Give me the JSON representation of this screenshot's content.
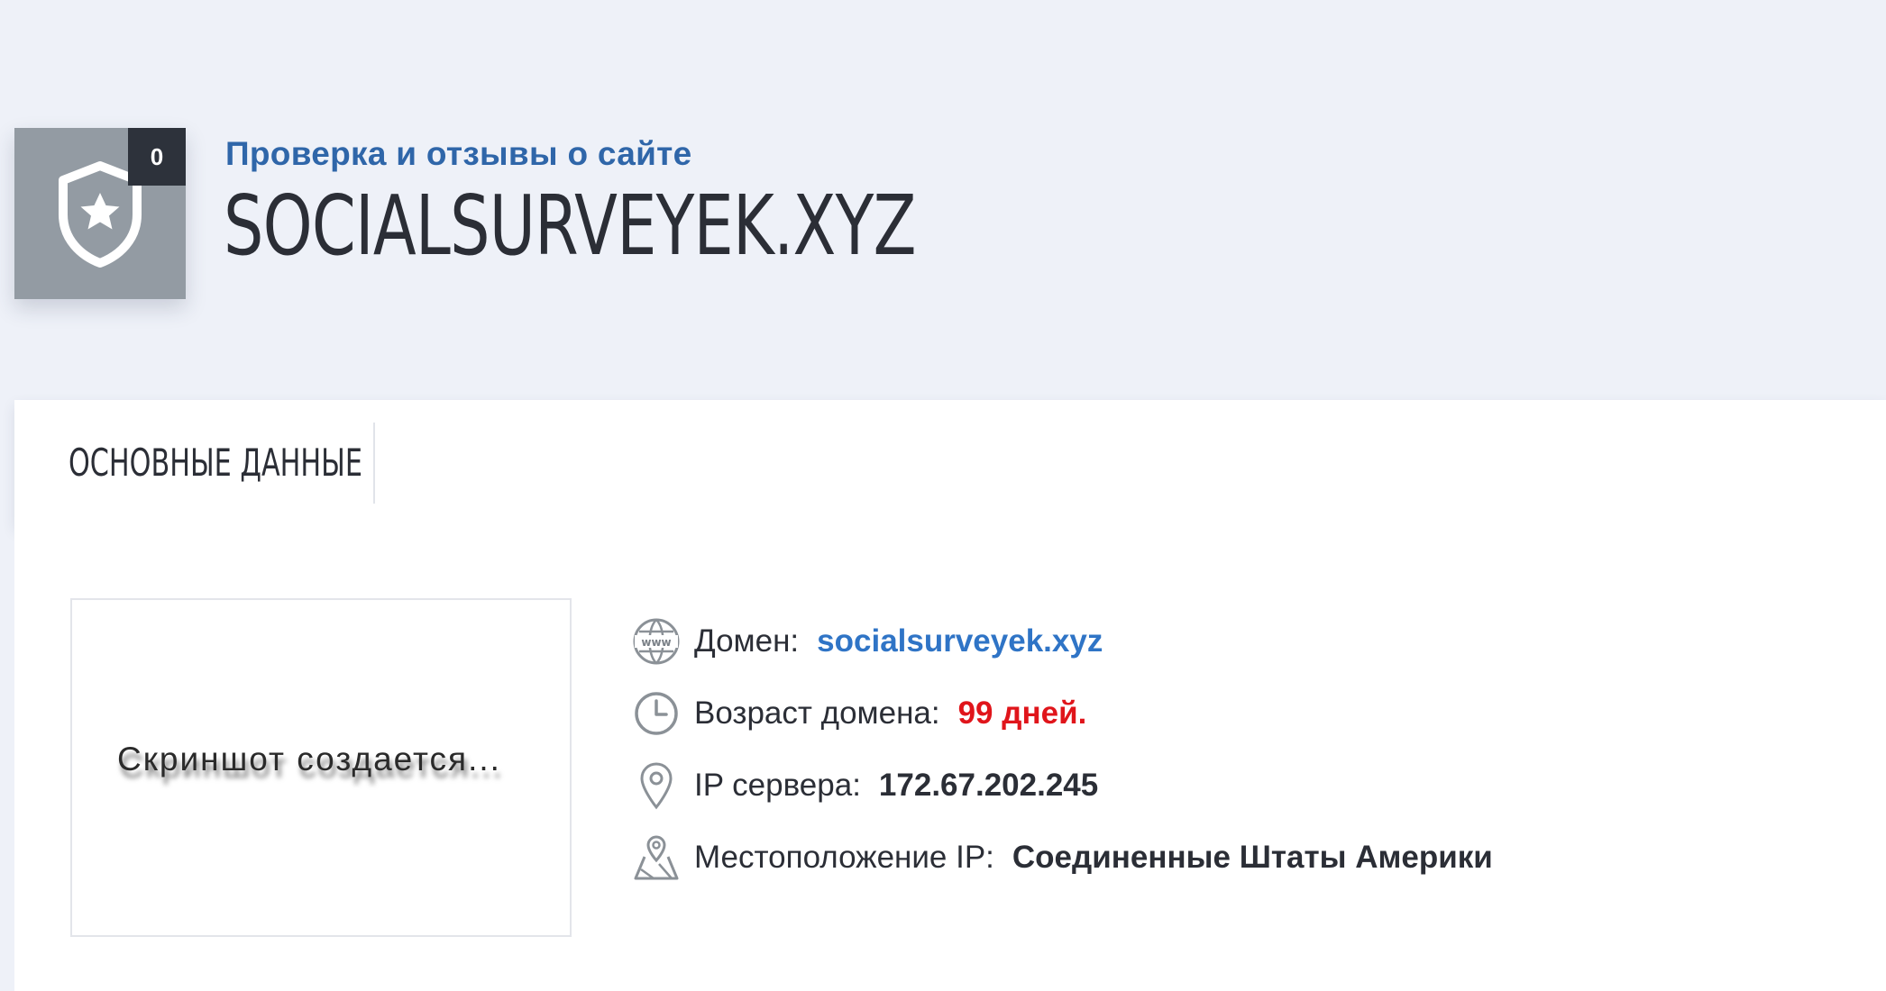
{
  "header": {
    "badge_count": "0",
    "subtitle": "Проверка и отзывы о сайте",
    "site_title": "SOCIALSURVEYEK.XYZ"
  },
  "tabs": [
    {
      "label": "ОСНОВНЫЕ ДАННЫЕ"
    }
  ],
  "screenshot": {
    "placeholder_text": "Скриншот создается..."
  },
  "info": {
    "domain": {
      "icon": "www-globe-icon",
      "label": "Домен:",
      "value": "socialsurveyek.xyz"
    },
    "age": {
      "icon": "clock-icon",
      "label": "Возраст домена:",
      "value": "99 дней."
    },
    "ip": {
      "icon": "map-pin-icon",
      "label": "IP сервера:",
      "value": "172.67.202.245"
    },
    "location": {
      "icon": "map-location-icon",
      "label": "Местоположение IP:",
      "value": "Соединенные Штаты Америки"
    }
  },
  "colors": {
    "page_background": "#eef1f8",
    "accent_blue": "#2f66a9",
    "link_blue": "#2f74c6",
    "warning_red": "#e0151b",
    "shield_tile": "#939ba3",
    "badge_dark": "#2d323b"
  }
}
